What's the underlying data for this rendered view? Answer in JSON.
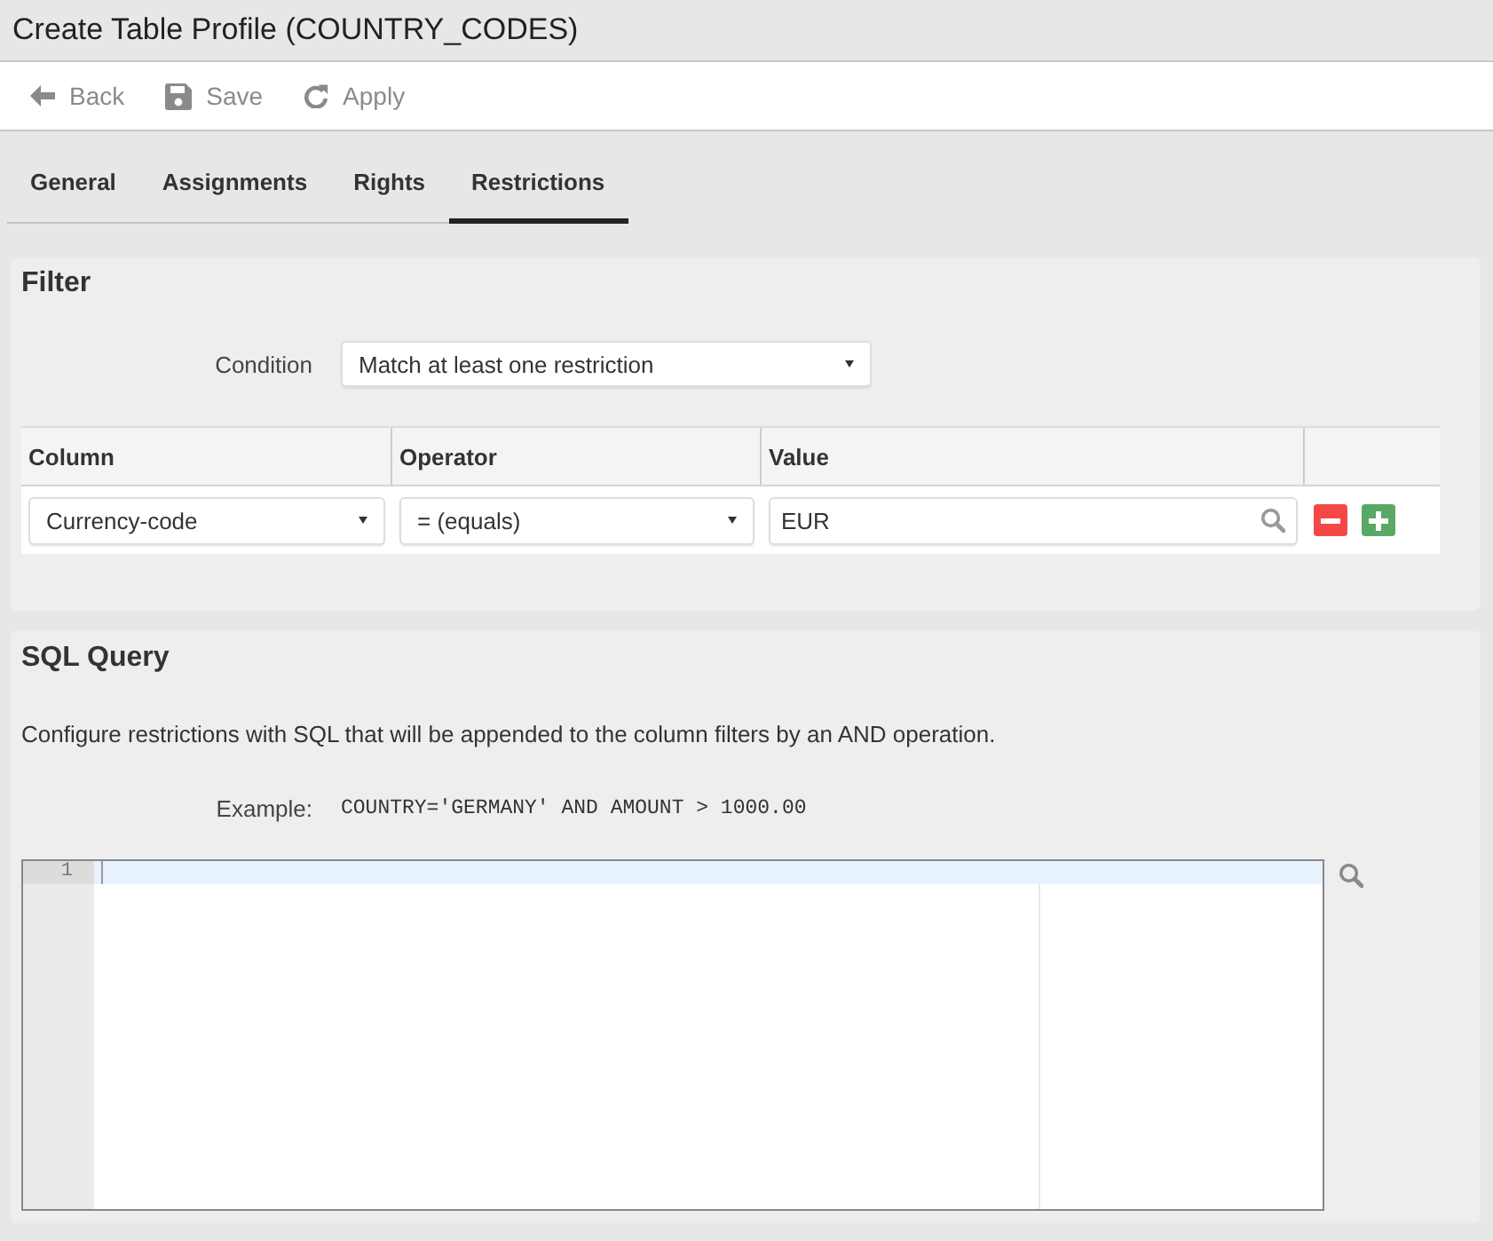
{
  "window": {
    "title": "Create Table Profile (COUNTRY_CODES)"
  },
  "toolbar": [
    {
      "kind": "back",
      "label": "Back"
    },
    {
      "kind": "save",
      "label": "Save"
    },
    {
      "kind": "apply",
      "label": "Apply"
    }
  ],
  "tabs": [
    {
      "label": "General",
      "selected": false
    },
    {
      "label": "Assignments",
      "selected": false
    },
    {
      "label": "Rights",
      "selected": false
    },
    {
      "label": "Restrictions",
      "selected": true
    }
  ],
  "filter": {
    "title": "Filter",
    "condition": {
      "label": "Condition",
      "value": "Match at least one restriction"
    },
    "table": {
      "columns": [
        "Column",
        "Operator",
        "Value"
      ],
      "rows": [
        {
          "column": "Currency-code",
          "operator": "= (equals)",
          "value": "EUR"
        }
      ]
    }
  },
  "sql_query": {
    "title": "SQL Query",
    "description": "Configure restrictions with SQL that will be appended to the column filters by an AND operation.",
    "example": {
      "label": "Example:",
      "code": "COUNTRY='GERMANY' AND AMOUNT > 1000.00"
    },
    "editor": {
      "lines": [
        {
          "number": "1",
          "current": true
        }
      ]
    }
  }
}
